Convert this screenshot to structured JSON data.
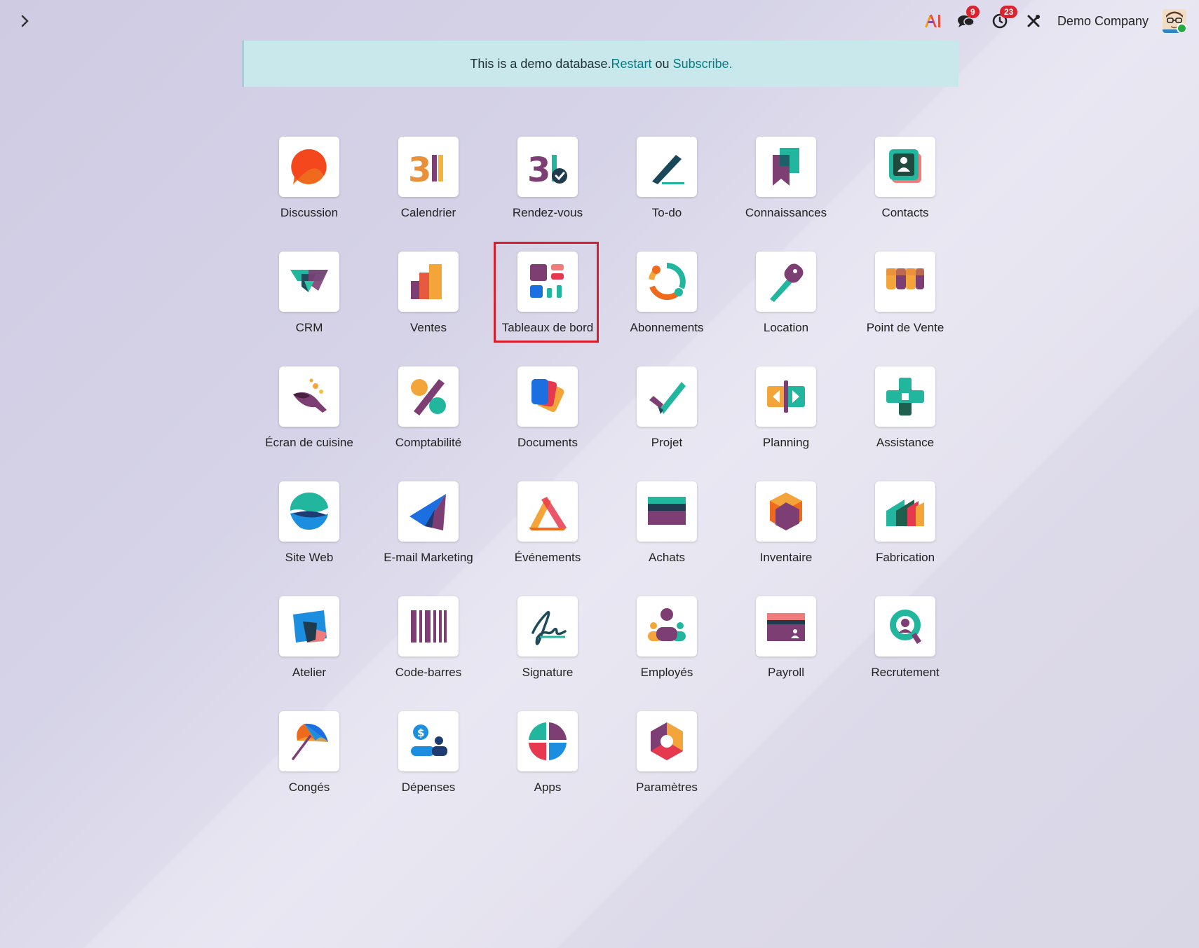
{
  "topbar": {
    "messages_badge": "9",
    "activities_badge": "23",
    "company_name": "Demo Company"
  },
  "banner": {
    "text": "This is a demo database. ",
    "restart_label": "Restart",
    "or_text": " ou ",
    "subscribe_label": "Subscribe."
  },
  "apps": [
    {
      "label": "Discussion"
    },
    {
      "label": "Calendrier"
    },
    {
      "label": "Rendez-vous"
    },
    {
      "label": "To-do"
    },
    {
      "label": "Connaissances"
    },
    {
      "label": "Contacts"
    },
    {
      "label": "CRM"
    },
    {
      "label": "Ventes"
    },
    {
      "label": "Tableaux de bord"
    },
    {
      "label": "Abonnements"
    },
    {
      "label": "Location"
    },
    {
      "label": "Point de Vente"
    },
    {
      "label": "Écran de cuisine"
    },
    {
      "label": "Comptabilité"
    },
    {
      "label": "Documents"
    },
    {
      "label": "Projet"
    },
    {
      "label": "Planning"
    },
    {
      "label": "Assistance"
    },
    {
      "label": "Site Web"
    },
    {
      "label": "E-mail Marketing"
    },
    {
      "label": "Événements"
    },
    {
      "label": "Achats"
    },
    {
      "label": "Inventaire"
    },
    {
      "label": "Fabrication"
    },
    {
      "label": "Atelier"
    },
    {
      "label": "Code-barres"
    },
    {
      "label": "Signature"
    },
    {
      "label": "Employés"
    },
    {
      "label": "Payroll"
    },
    {
      "label": "Recrutement"
    },
    {
      "label": "Congés"
    },
    {
      "label": "Dépenses"
    },
    {
      "label": "Apps"
    },
    {
      "label": "Paramètres"
    }
  ],
  "colors": {
    "accent": "#017e84",
    "badge": "#d9232e",
    "highlight_box": "#d51f2c"
  }
}
